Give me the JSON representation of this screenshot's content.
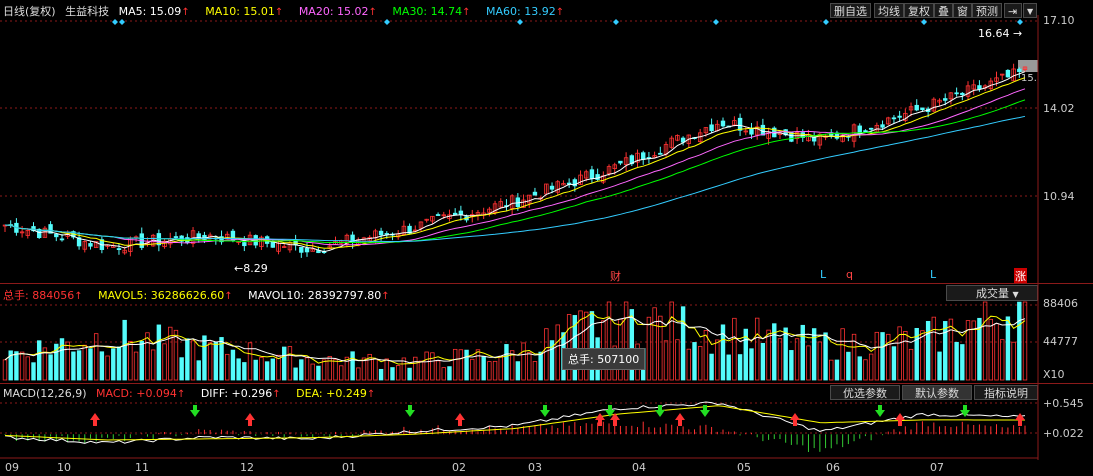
{
  "header": {
    "title": "日线(复权)",
    "stock_name": "生益科技",
    "ma": [
      {
        "label": "MA5: 15.09",
        "color": "#ffffff"
      },
      {
        "label": "MA10: 15.01",
        "color": "#ffff00"
      },
      {
        "label": "MA20: 15.02",
        "color": "#ff66ff"
      },
      {
        "label": "MA30: 14.74",
        "color": "#00ff00"
      },
      {
        "label": "MA60: 13.92",
        "color": "#33ccff"
      }
    ]
  },
  "toolbar": {
    "buttons": [
      "删自选",
      "均线",
      "复权",
      "叠",
      "窗",
      "预测"
    ]
  },
  "price_axis": {
    "ticks": [
      "17.10",
      "14.02",
      "10.94"
    ],
    "last_price": "15."
  },
  "annotations": {
    "high": "16.64",
    "low": "8.29"
  },
  "event_markers": [
    {
      "label": "财",
      "color": "#ff4444"
    },
    {
      "label": "L",
      "color": "#33ccff"
    },
    {
      "label": "q",
      "color": "#ff4444"
    },
    {
      "label": "L",
      "color": "#33ccff"
    },
    {
      "label": "涨",
      "color": "#ffffff"
    }
  ],
  "volume": {
    "total": "总手: 884056",
    "mavol5": "MAVOL5: 36286626.60",
    "mavol10": "MAVOL10: 28392797.80",
    "selector": "成交量",
    "ticks": [
      "88406",
      "44777"
    ],
    "unit": "X10",
    "tooltip": "总手: 507100"
  },
  "macd": {
    "title": "MACD(12,26,9)",
    "macd": "MACD: +0.094",
    "diff": "DIFF: +0.296",
    "dea": "DEA: +0.249",
    "ticks": [
      "+0.545",
      "+0.022"
    ],
    "tabs": [
      "优选参数",
      "默认参数",
      "指标说明"
    ]
  },
  "dates": [
    "09",
    "10",
    "11",
    "12",
    "01",
    "02",
    "03",
    "04",
    "05",
    "06",
    "07"
  ],
  "chart_data": {
    "type": "candlestick",
    "title": "日线(复权) 生益科技",
    "x": [
      "09",
      "10",
      "11",
      "12",
      "01",
      "02",
      "03",
      "04",
      "05",
      "06",
      "07"
    ],
    "close": [
      9.4,
      8.6,
      9.0,
      8.5,
      9.3,
      10.3,
      11.6,
      13.3,
      12.6,
      13.8,
      15.2
    ],
    "ylim": [
      8.0,
      17.1
    ],
    "volume": [
      300,
      520,
      380,
      250,
      220,
      320,
      760,
      560,
      420,
      480,
      884
    ],
    "volume_ylim": [
      0,
      884.06
    ],
    "macd_diff": [
      -0.05,
      -0.15,
      -0.05,
      -0.08,
      0.05,
      0.15,
      0.45,
      0.55,
      0.05,
      0.35,
      0.296
    ],
    "macd_dea": [
      -0.02,
      -0.1,
      -0.08,
      -0.06,
      0.0,
      0.1,
      0.35,
      0.5,
      0.2,
      0.25,
      0.249
    ],
    "macd_ylim": [
      -0.4,
      0.7
    ]
  }
}
